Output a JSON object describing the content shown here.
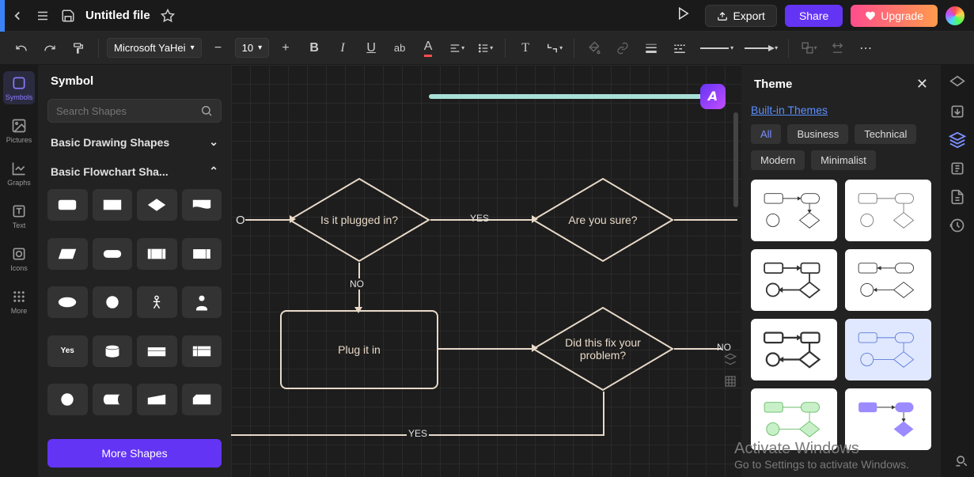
{
  "file": {
    "title": "Untitled file"
  },
  "topbar": {
    "export": "Export",
    "share": "Share",
    "upgrade": "Upgrade"
  },
  "toolbar": {
    "font": "Microsoft YaHei",
    "size": "10"
  },
  "leftrail": {
    "symbols": "Symbols",
    "pictures": "Pictures",
    "graphs": "Graphs",
    "text": "Text",
    "icons": "Icons",
    "more": "More"
  },
  "symbol": {
    "title": "Symbol",
    "search_placeholder": "Search Shapes",
    "cat_basic_drawing": "Basic Drawing Shapes",
    "cat_basic_flowchart": "Basic Flowchart Sha...",
    "yes_label": "Yes",
    "more_shapes": "More Shapes"
  },
  "flowchart": {
    "start_o": "O",
    "plugged": "Is it plugged in?",
    "yes1": "YES",
    "sure": "Are you sure?",
    "no1": "NO",
    "plug": "Plug it in",
    "fix": "Did this fix your problem?",
    "no2": "NO",
    "yes2": "YES"
  },
  "theme": {
    "title": "Theme",
    "builtin": "Built-in Themes",
    "all": "All",
    "business": "Business",
    "technical": "Technical",
    "modern": "Modern",
    "minimalist": "Minimalist"
  },
  "watermark": {
    "t1": "Activate Windows",
    "t2": "Go to Settings to activate Windows."
  }
}
